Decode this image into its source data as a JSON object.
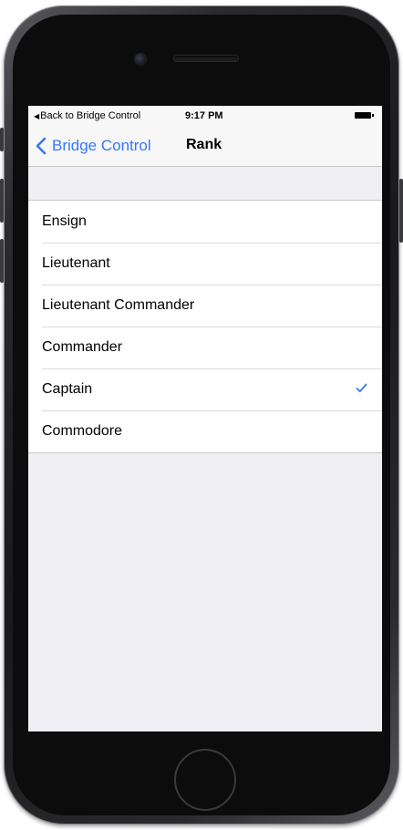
{
  "status_bar": {
    "back_app": "Back to Bridge Control",
    "time": "9:17 PM"
  },
  "nav": {
    "back_label": "Bridge Control",
    "title": "Rank"
  },
  "ranks": [
    {
      "label": "Ensign",
      "selected": false
    },
    {
      "label": "Lieutenant",
      "selected": false
    },
    {
      "label": "Lieutenant Commander",
      "selected": false
    },
    {
      "label": "Commander",
      "selected": false
    },
    {
      "label": "Captain",
      "selected": true
    },
    {
      "label": "Commodore",
      "selected": false
    }
  ],
  "colors": {
    "accent": "#3478f6",
    "background": "#efeff4"
  }
}
